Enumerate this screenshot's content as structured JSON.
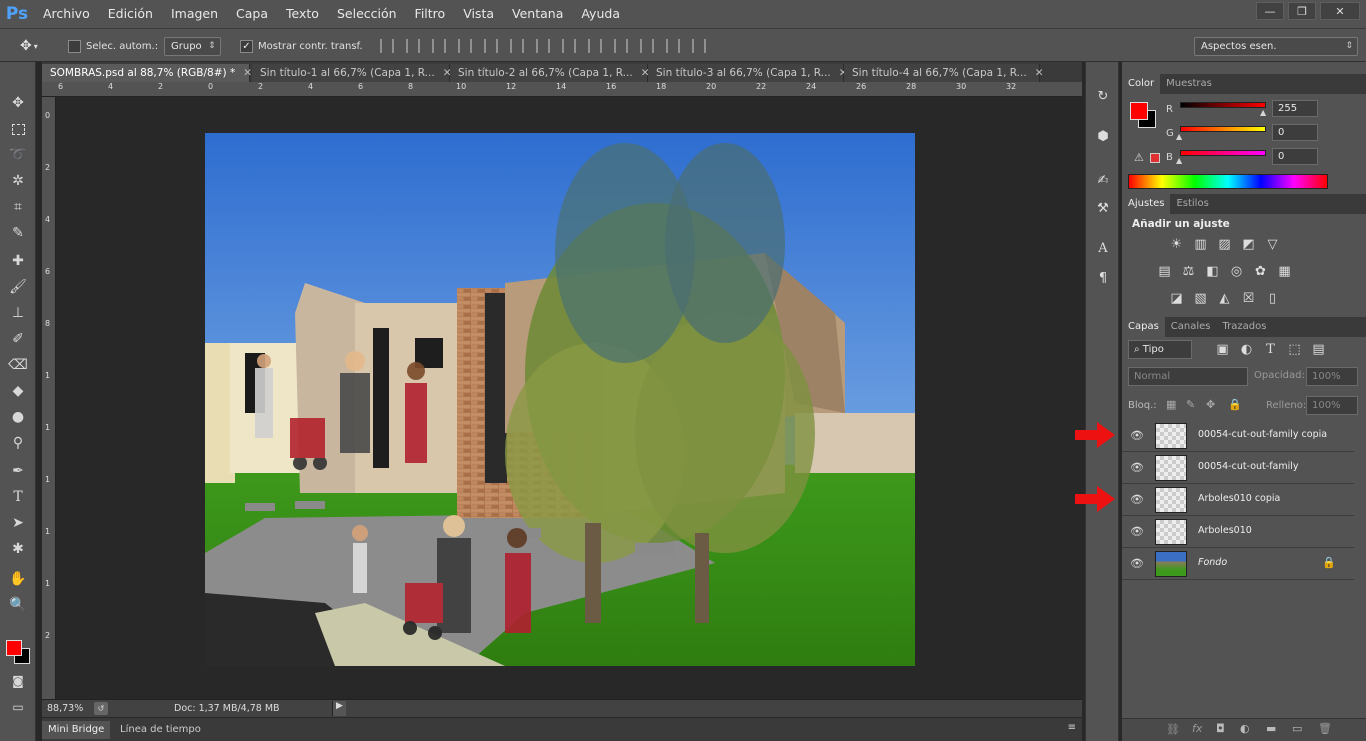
{
  "menubar": {
    "logo": "Ps",
    "items": [
      "Archivo",
      "Edición",
      "Imagen",
      "Capa",
      "Texto",
      "Selección",
      "Filtro",
      "Vista",
      "Ventana",
      "Ayuda"
    ],
    "window_controls": [
      "—",
      "❐",
      "✕"
    ]
  },
  "options": {
    "auto_select_label": "Selec. autom.:",
    "auto_select_value": "Grupo",
    "show_transform_label": "Mostrar contr. transf.",
    "workspace": "Aspectos esen."
  },
  "tabs": [
    {
      "label": "SOMBRAS.psd al 88,7% (RGB/8#) *",
      "active": true
    },
    {
      "label": "Sin título-1 al 66,7% (Capa 1, R...",
      "active": false
    },
    {
      "label": "Sin título-2 al 66,7% (Capa 1, R...",
      "active": false
    },
    {
      "label": "Sin título-3 al 66,7% (Capa 1, R...",
      "active": false
    },
    {
      "label": "Sin título-4 al 66,7% (Capa 1, R...",
      "active": false
    }
  ],
  "ruler": {
    "top": [
      "6",
      "4",
      "2",
      "0",
      "2",
      "4",
      "6",
      "8",
      "10",
      "12",
      "14",
      "16",
      "18",
      "20",
      "22",
      "24",
      "26",
      "28",
      "30",
      "32"
    ],
    "left": [
      "0",
      "2",
      "4",
      "6",
      "8",
      "1",
      "1",
      "1",
      "1",
      "1",
      "2"
    ]
  },
  "status": {
    "zoom": "88,73%",
    "doc": "Doc: 1,37 MB/4,78 MB"
  },
  "bottom_tabs": [
    "Mini Bridge",
    "Línea de tiempo"
  ],
  "color_panel": {
    "tabs": [
      "Color",
      "Muestras"
    ],
    "channels": [
      {
        "label": "R",
        "value": "255"
      },
      {
        "label": "G",
        "value": "0"
      },
      {
        "label": "B",
        "value": "0"
      }
    ],
    "foreground": "#ff0000"
  },
  "adjust_panel": {
    "tabs": [
      "Ajustes",
      "Estilos"
    ],
    "title": "Añadir un ajuste"
  },
  "layers_panel": {
    "tabs": [
      "Capas",
      "Canales",
      "Trazados"
    ],
    "filter": "Tipo",
    "blend_mode": "Normal",
    "opacity_label": "Opacidad:",
    "opacity_value": "100%",
    "lock_label": "Bloq.:",
    "fill_label": "Relleno:",
    "fill_value": "100%",
    "layers": [
      {
        "name": "00054-cut-out-family copia",
        "locked": false,
        "marked": true
      },
      {
        "name": "00054-cut-out-family",
        "locked": false,
        "marked": false
      },
      {
        "name": "Arboles010 copia",
        "locked": false,
        "marked": true
      },
      {
        "name": "Arboles010",
        "locked": false,
        "marked": false
      },
      {
        "name": "Fondo",
        "locked": true,
        "marked": false
      }
    ]
  }
}
